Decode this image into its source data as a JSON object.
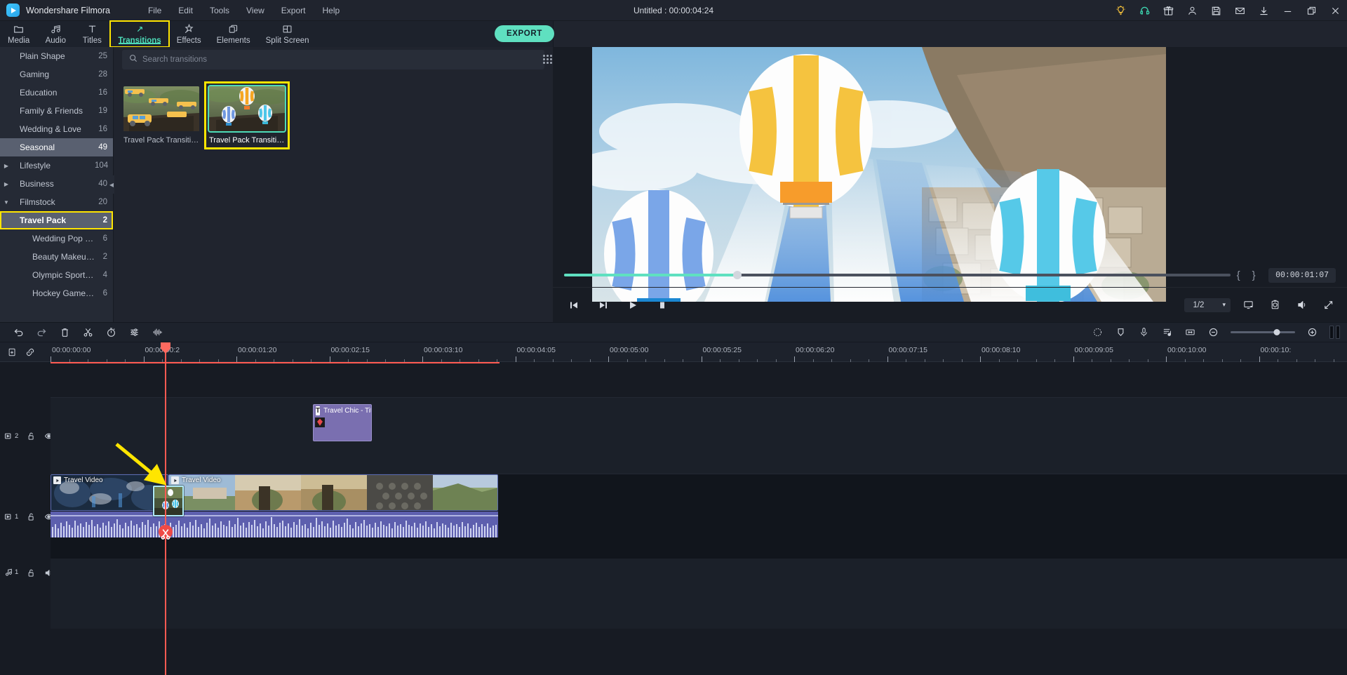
{
  "titlebar": {
    "app_name": "Wondershare Filmora",
    "document_title": "Untitled : 00:00:04:24",
    "menus": [
      "File",
      "Edit",
      "Tools",
      "View",
      "Export",
      "Help"
    ],
    "sys_icons": [
      {
        "name": "lightbulb-icon",
        "label": "Tips"
      },
      {
        "name": "headset-icon",
        "label": "Support"
      },
      {
        "name": "gift-icon",
        "label": "Gift"
      },
      {
        "name": "account-icon",
        "label": "Account"
      },
      {
        "name": "save-icon",
        "label": "Save"
      },
      {
        "name": "mail-icon",
        "label": "Mail"
      },
      {
        "name": "download-icon",
        "label": "Download"
      },
      {
        "name": "minimize-icon",
        "label": "Minimize"
      },
      {
        "name": "restore-icon",
        "label": "Restore"
      },
      {
        "name": "close-icon",
        "label": "Close"
      }
    ]
  },
  "toolbar": {
    "tabs": [
      {
        "label": "Media",
        "icon": "folder-icon",
        "active": false
      },
      {
        "label": "Audio",
        "icon": "music-note-icon",
        "active": false
      },
      {
        "label": "Titles",
        "icon": "text-t-icon",
        "active": false
      },
      {
        "label": "Transitions",
        "icon": "transition-arrows-icon",
        "active": true
      },
      {
        "label": "Effects",
        "icon": "magic-wand-icon",
        "active": false
      },
      {
        "label": "Elements",
        "icon": "stacked-squares-icon",
        "active": false
      },
      {
        "label": "Split Screen",
        "icon": "split-screen-icon",
        "active": false
      }
    ],
    "export_label": "EXPORT"
  },
  "categories": [
    {
      "label": "Plain Shape",
      "count": "25",
      "indent": 1,
      "caret": "",
      "state": "normal"
    },
    {
      "label": "Gaming",
      "count": "28",
      "indent": 1,
      "caret": "",
      "state": "normal"
    },
    {
      "label": "Education",
      "count": "16",
      "indent": 1,
      "caret": "",
      "state": "normal"
    },
    {
      "label": "Family & Friends",
      "count": "19",
      "indent": 1,
      "caret": "",
      "state": "normal"
    },
    {
      "label": "Wedding & Love",
      "count": "16",
      "indent": 1,
      "caret": "",
      "state": "normal"
    },
    {
      "label": "Seasonal",
      "count": "49",
      "indent": 1,
      "caret": "",
      "state": "selected"
    },
    {
      "label": "Lifestyle",
      "count": "104",
      "indent": 0,
      "caret": "collapsed",
      "state": "normal"
    },
    {
      "label": "Business",
      "count": "40",
      "indent": 0,
      "caret": "collapsed",
      "state": "normal"
    },
    {
      "label": "Filmstock",
      "count": "20",
      "indent": 0,
      "caret": "expanded",
      "state": "normal"
    },
    {
      "label": "Travel Pack",
      "count": "2",
      "indent": 1,
      "caret": "",
      "state": "selected-boxed"
    },
    {
      "label": "Wedding Pop Up Pa",
      "count": "6",
      "indent": 2,
      "caret": "",
      "state": "normal"
    },
    {
      "label": "Beauty Makeup Pac",
      "count": "2",
      "indent": 2,
      "caret": "",
      "state": "normal"
    },
    {
      "label": "Olympic Sports Pack",
      "count": "4",
      "indent": 2,
      "caret": "",
      "state": "normal"
    },
    {
      "label": "Hockey Game Pack",
      "count": "6",
      "indent": 2,
      "caret": "",
      "state": "normal"
    }
  ],
  "search": {
    "placeholder": "Search transitions",
    "value": "",
    "icon": "search-icon",
    "grid_toggle_icon": "grid-dots-icon"
  },
  "transitions": [
    {
      "label": "Travel Pack Transitio...",
      "selected": false,
      "thumb": "jeeps"
    },
    {
      "label": "Travel Pack Transitio...",
      "selected": true,
      "thumb": "balloons"
    }
  ],
  "preview": {
    "progress_percent": 26,
    "current_time": "00:00:01:07",
    "mark_in_icon": "{",
    "mark_out_icon": "}",
    "controls": [
      {
        "name": "prev-frame-button",
        "icon": "step-back-icon"
      },
      {
        "name": "next-frame-button",
        "icon": "step-forward-icon"
      },
      {
        "name": "play-button",
        "icon": "play-icon"
      },
      {
        "name": "stop-button",
        "icon": "stop-icon"
      }
    ],
    "zoom_level": "1/2",
    "right_icons": [
      {
        "name": "display-settings-icon"
      },
      {
        "name": "snapshot-icon"
      },
      {
        "name": "volume-icon"
      },
      {
        "name": "fullscreen-icon"
      }
    ]
  },
  "timeline_toolbar": {
    "left_icons": [
      {
        "name": "undo-icon"
      },
      {
        "name": "redo-icon"
      },
      {
        "name": "delete-icon"
      },
      {
        "name": "split-scissors-icon"
      },
      {
        "name": "speed-stopwatch-icon"
      },
      {
        "name": "color-settings-icon"
      },
      {
        "name": "audio-waveform-icon"
      }
    ],
    "right_icons": [
      {
        "name": "keyframe-icon"
      },
      {
        "name": "marker-icon"
      },
      {
        "name": "voiceover-mic-icon"
      },
      {
        "name": "audio-mixer-icon"
      },
      {
        "name": "fit-timeline-icon"
      },
      {
        "name": "zoom-out-icon"
      },
      {
        "name": "zoom-in-icon"
      },
      {
        "name": "render-preview-icon"
      }
    ],
    "zoom_position_percent": 72
  },
  "ruler": {
    "icons": [
      {
        "name": "add-marker-icon"
      },
      {
        "name": "link-icon"
      }
    ],
    "labels": [
      "00:00:00:00",
      "00:00:00:2",
      "00:00:01:20",
      "00:00:02:15",
      "00:00:03:10",
      "00:00:04:05",
      "00:00:05:00",
      "00:00:05:25",
      "00:00:06:20",
      "00:00:07:15",
      "00:00:08:10",
      "00:00:09:05",
      "00:00:10:00",
      "00:00:10:"
    ]
  },
  "tracks": [
    {
      "name": "video-track-2",
      "label": "2",
      "type": "video",
      "icons": [
        "track-video-icon",
        "unlock-icon",
        "eye-icon"
      ]
    },
    {
      "name": "video-track-1",
      "label": "1",
      "type": "video",
      "icons": [
        "track-video-icon",
        "unlock-icon",
        "eye-icon"
      ]
    },
    {
      "name": "audio-track-1",
      "label": "1",
      "type": "audio",
      "icons": [
        "track-audio-icon",
        "unlock-icon",
        "speaker-icon"
      ]
    }
  ],
  "clips": [
    {
      "name": "title-clip",
      "label": "Travel Chic - Title",
      "track": "video-track-2",
      "badge": "T"
    },
    {
      "name": "video-clip-1",
      "label": "Travel Video",
      "track": "video-track-1"
    },
    {
      "name": "video-clip-2",
      "label": "Travel Video",
      "track": "video-track-1"
    }
  ],
  "transition_on_timeline": {
    "name": "travel-pack-transition-chip",
    "selected": true
  },
  "annotation": {
    "name": "yellow-arrow-annotation",
    "color": "#ffe500"
  },
  "colors": {
    "accent_teal": "#4ddbb8",
    "highlight_yellow": "#ffe500",
    "playhead_red": "#ff5a52",
    "clip_purple": "#7a6fb0",
    "bg_dark": "#1b2029"
  }
}
